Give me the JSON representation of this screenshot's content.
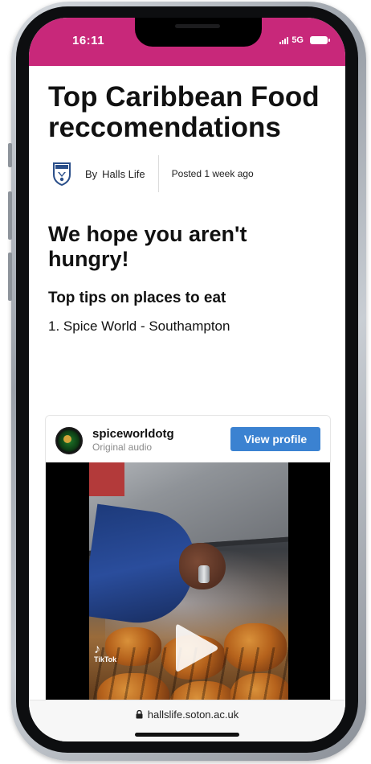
{
  "status_bar": {
    "time": "16:11",
    "network": "5G",
    "background_color": "#c8287a"
  },
  "article": {
    "title": "Top Caribbean Food reccomendations",
    "byline": {
      "prefix": "By",
      "author": "Halls Life",
      "posted": "Posted 1 week ago",
      "avatar_icon": "halls-life-shield-icon"
    },
    "subtitle": "We hope you aren't hungry!",
    "section_heading": "Top tips on places to eat",
    "list": [
      "1. Spice World - Southampton"
    ]
  },
  "embed": {
    "username": "spiceworldotg",
    "audio": "Original audio",
    "view_profile_label": "View profile",
    "button_color": "#3b82d1",
    "video": {
      "watermark": "TikTok",
      "play_icon": "play-icon"
    }
  },
  "browser": {
    "url": "hallslife.soton.ac.uk",
    "lock_icon": "lock-icon"
  }
}
